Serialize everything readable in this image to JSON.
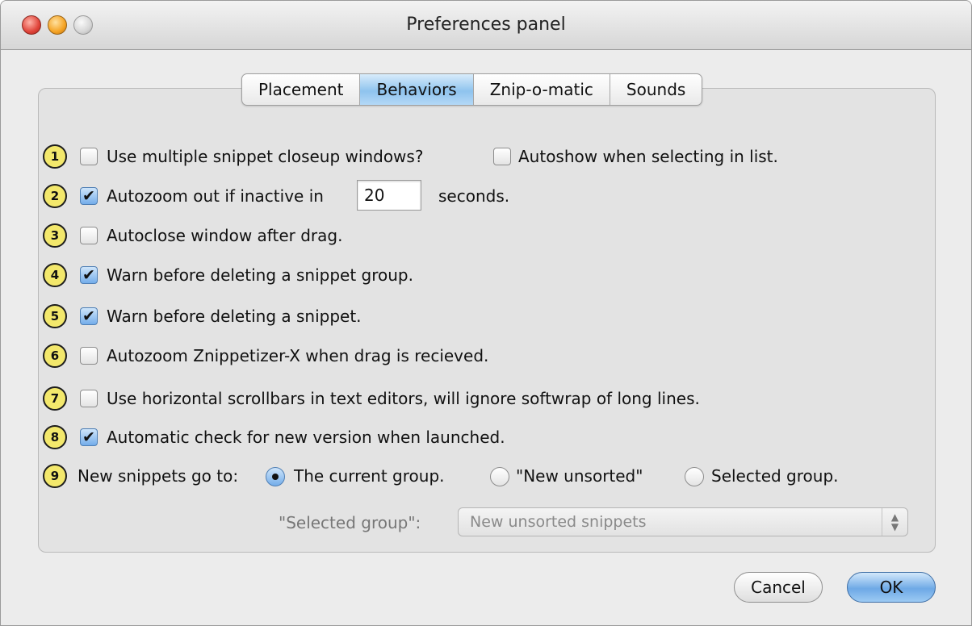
{
  "window": {
    "title": "Preferences panel"
  },
  "tabs": [
    {
      "label": "Placement"
    },
    {
      "label": "Behaviors",
      "selected": true
    },
    {
      "label": "Znip-o-matic"
    },
    {
      "label": "Sounds"
    }
  ],
  "options": {
    "o1": {
      "badge": "1",
      "label": "Use multiple snippet closeup windows?",
      "checked": false,
      "extra": {
        "label": "Autoshow when selecting in list.",
        "checked": false
      }
    },
    "o2": {
      "badge": "2",
      "label": "Autozoom out if inactive in",
      "checked": true,
      "value": "20",
      "suffix": "seconds."
    },
    "o3": {
      "badge": "3",
      "label": "Autoclose window after drag.",
      "checked": false
    },
    "o4": {
      "badge": "4",
      "label": "Warn before deleting a snippet group.",
      "checked": true
    },
    "o5": {
      "badge": "5",
      "label": "Warn before deleting a snippet.",
      "checked": true
    },
    "o6": {
      "badge": "6",
      "label": "Autozoom Znippetizer-X when drag is recieved.",
      "checked": false
    },
    "o7": {
      "badge": "7",
      "label": "Use horizontal scrollbars in text editors, will ignore softwrap of long lines.",
      "checked": false
    },
    "o8": {
      "badge": "8",
      "label": "Automatic check for new version when launched.",
      "checked": true
    },
    "o9": {
      "badge": "9",
      "label": "New snippets go to:",
      "radios": [
        {
          "label": "The current group.",
          "selected": true
        },
        {
          "label": "\"New unsorted\"",
          "selected": false
        },
        {
          "label": "Selected group.",
          "selected": false
        }
      ]
    }
  },
  "selected_group": {
    "label": "\"Selected group\":",
    "value": "New unsorted snippets",
    "enabled": false
  },
  "buttons": {
    "cancel": "Cancel",
    "ok": "OK"
  },
  "icons": {
    "check": "✔",
    "updown": "⬍"
  },
  "colors": {
    "badge": "#f3e86c",
    "accent": "#74adea"
  }
}
